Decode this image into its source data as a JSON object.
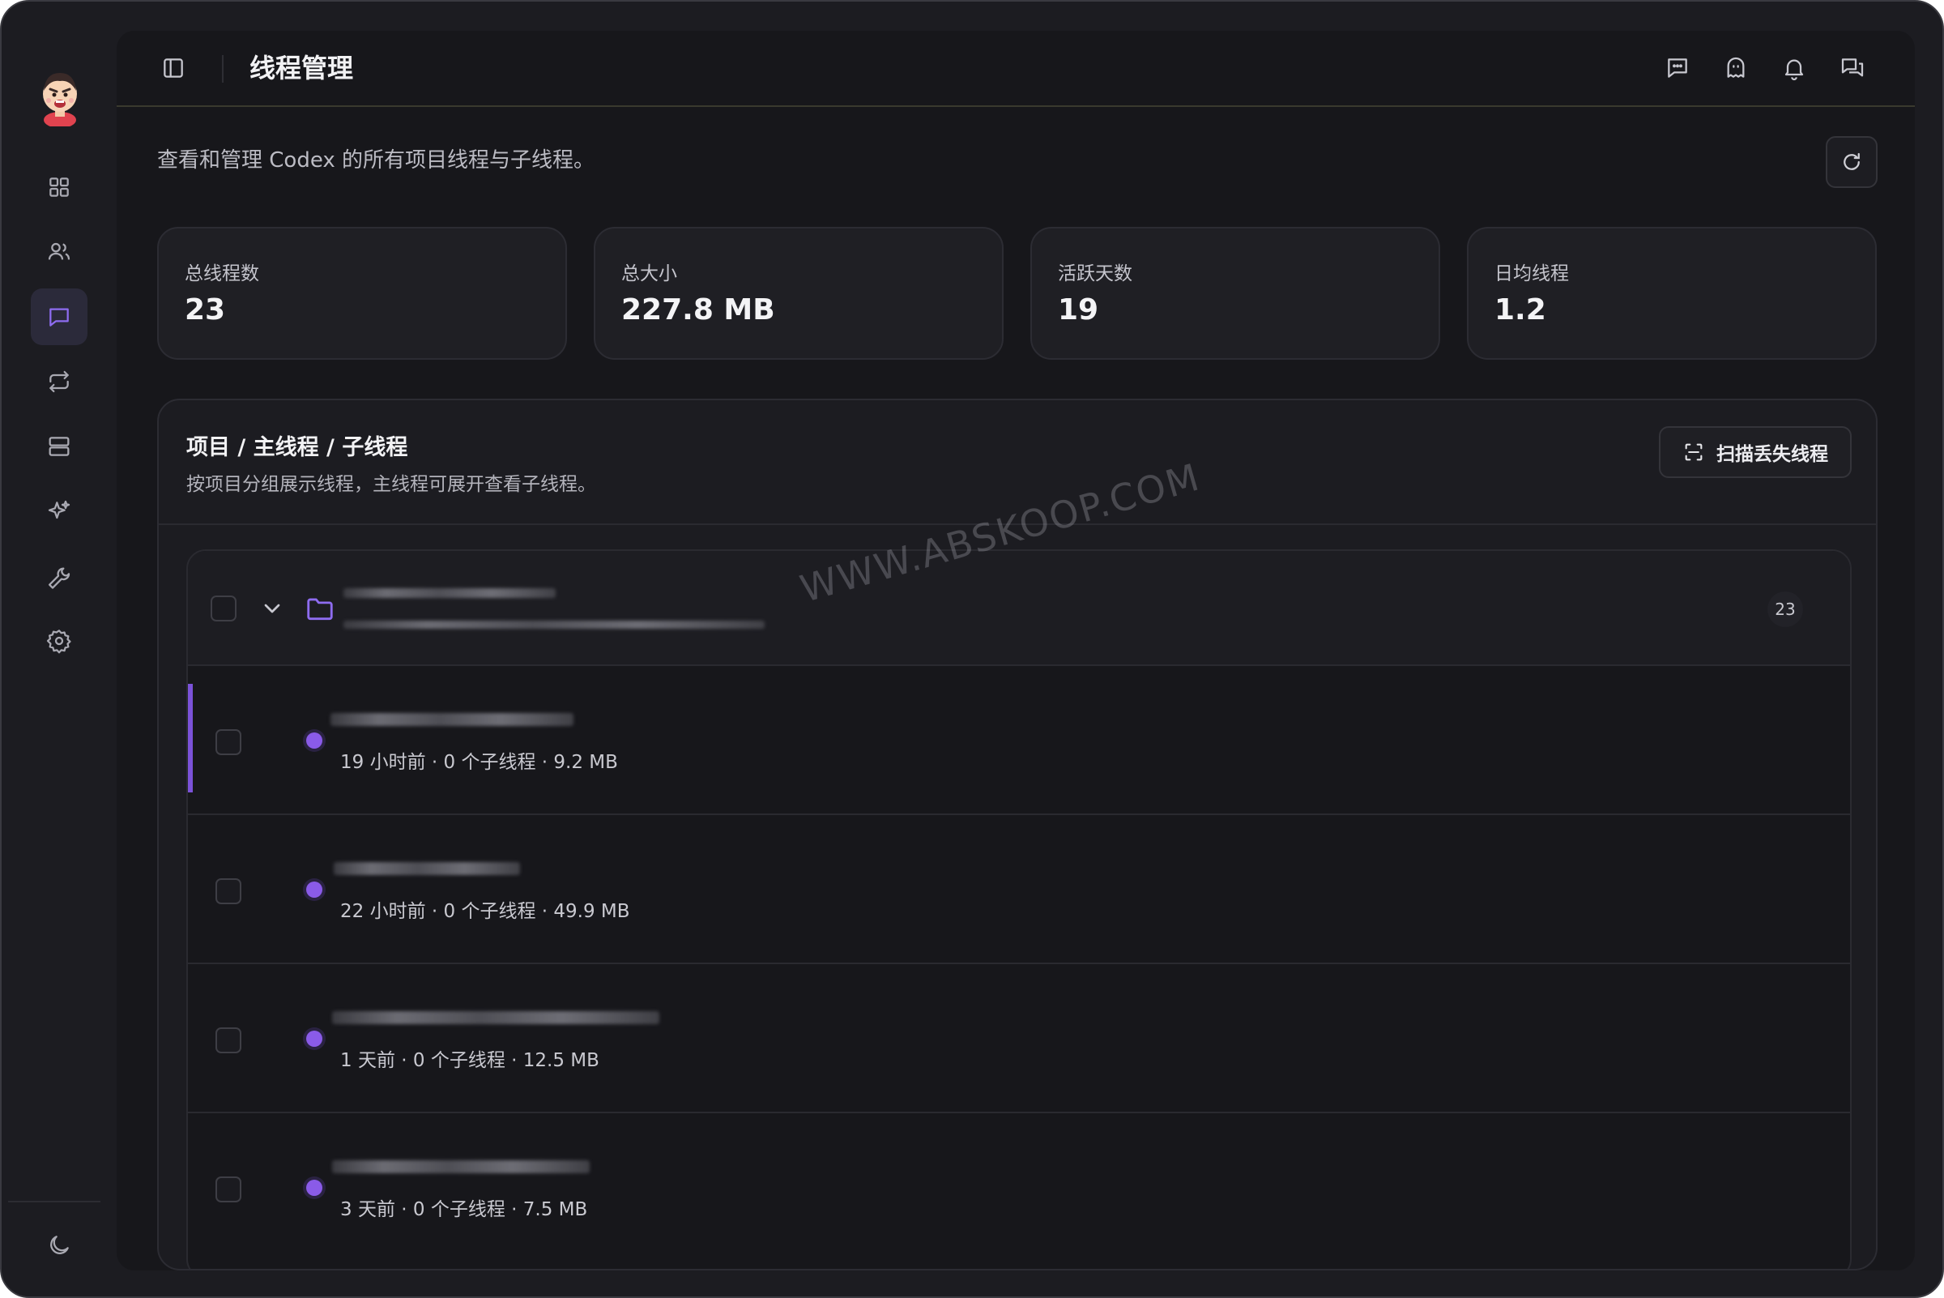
{
  "window": {
    "traffic_lights": {
      "close": "#fe5f57",
      "minimize": "#febc2e",
      "maximize": "#28c840"
    }
  },
  "sidebar": {
    "items": [
      {
        "icon": "dashboard-grid-icon",
        "active": false
      },
      {
        "icon": "users-icon",
        "active": false
      },
      {
        "icon": "chat-bubble-icon",
        "active": true
      },
      {
        "icon": "sync-arrows-icon",
        "active": false
      },
      {
        "icon": "storage-icon",
        "active": false
      },
      {
        "icon": "sparkles-icon",
        "active": false
      },
      {
        "icon": "wrench-icon",
        "active": false
      },
      {
        "icon": "gear-icon",
        "active": false
      }
    ],
    "bottom_icon": "moon-icon"
  },
  "header": {
    "title": "线程管理",
    "icons": [
      "toggle-sidebar-icon",
      "message-icon",
      "ghost-icon",
      "bell-icon",
      "conversations-icon"
    ]
  },
  "page": {
    "description": "查看和管理 Codex 的所有项目线程与子线程。"
  },
  "stats": [
    {
      "label": "总线程数",
      "value": "23"
    },
    {
      "label": "总大小",
      "value": "227.8 MB"
    },
    {
      "label": "活跃天数",
      "value": "19"
    },
    {
      "label": "日均线程",
      "value": "1.2"
    }
  ],
  "panel": {
    "title": "项目 / 主线程 / 子线程",
    "description": "按项目分组展示线程，主线程可展开查看子线程。",
    "scan_button": "扫描丢失线程"
  },
  "group": {
    "count": "23"
  },
  "threads": [
    {
      "meta": "19 小时前 · 0 个子线程 · 9.2 MB",
      "selected": true
    },
    {
      "meta": "22 小时前 · 0 个子线程 · 49.9 MB",
      "selected": false
    },
    {
      "meta": "1 天前 · 0 个子线程 · 12.5 MB",
      "selected": false
    },
    {
      "meta": "3 天前 · 0 个子线程 · 7.5 MB",
      "selected": false
    }
  ],
  "watermark": "WWW.ABSKOOP.COM",
  "colors": {
    "accent": "#7b52d9",
    "dot": "#8a5be8",
    "background": "#17171b",
    "card": "#1f1f24"
  }
}
